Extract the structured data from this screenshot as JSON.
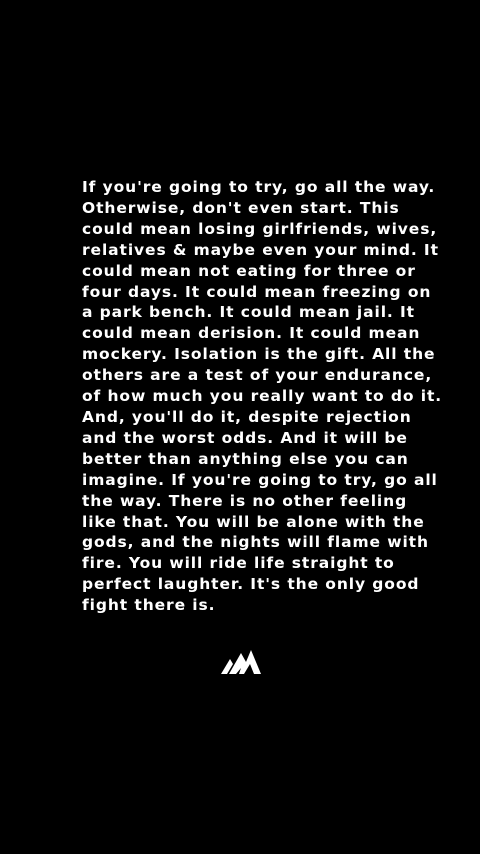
{
  "quote": {
    "lines": [
      "If you're going to try, go all the way.",
      "Otherwise, don't even start. This",
      "could mean losing girlfriends, wives,",
      "relatives & maybe even your mind. It",
      "could mean not eating for three or",
      "four days. It could mean freezing on",
      "a park bench. It could mean jail. It",
      "could mean derision. It could mean",
      "mockery. Isolation is the gift. All the",
      "others are a test of your endurance,",
      "of how much you really want to do it.",
      "And, you'll do it, despite rejection",
      "and the worst odds. And it will be",
      "better than anything else you can",
      "imagine. If you're going to try, go all",
      "the way. There is no other feeling",
      "like that. You will be alone with the",
      "gods, and the nights will flame with",
      "fire. You will ride life straight to",
      "perfect laughter. It's the only good",
      "fight there is."
    ]
  },
  "logo": {
    "icon": "mountain-m-logo-icon",
    "color": "#ffffff"
  },
  "colors": {
    "background": "#000000",
    "text": "#ffffff"
  }
}
